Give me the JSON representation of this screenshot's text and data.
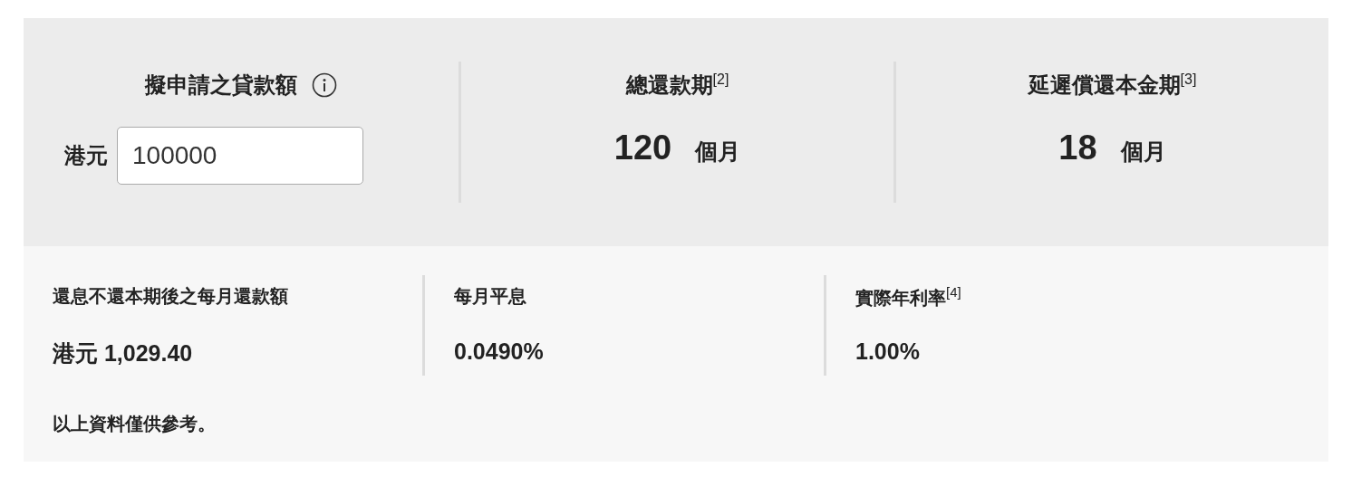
{
  "loan_amount": {
    "label": "擬申請之貸款額",
    "currency": "港元",
    "value": "100000"
  },
  "terms": [
    {
      "label": "總還款期$^{[2]}$",
      "value": "120",
      "unit": "個月"
    },
    {
      "label": "延遲償還本金期$^{[3]}$",
      "value": "18",
      "unit": "個月"
    }
  ],
  "results": [
    {
      "label": "還息不還本期後之每月還款額",
      "value": "港元 1,029.40"
    },
    {
      "label": "每月平息",
      "value": "0.0490%"
    },
    {
      "label": "實際年利率$^{[4]}$",
      "value": "1.00%"
    }
  ],
  "note": "以上資料僅供參考。"
}
